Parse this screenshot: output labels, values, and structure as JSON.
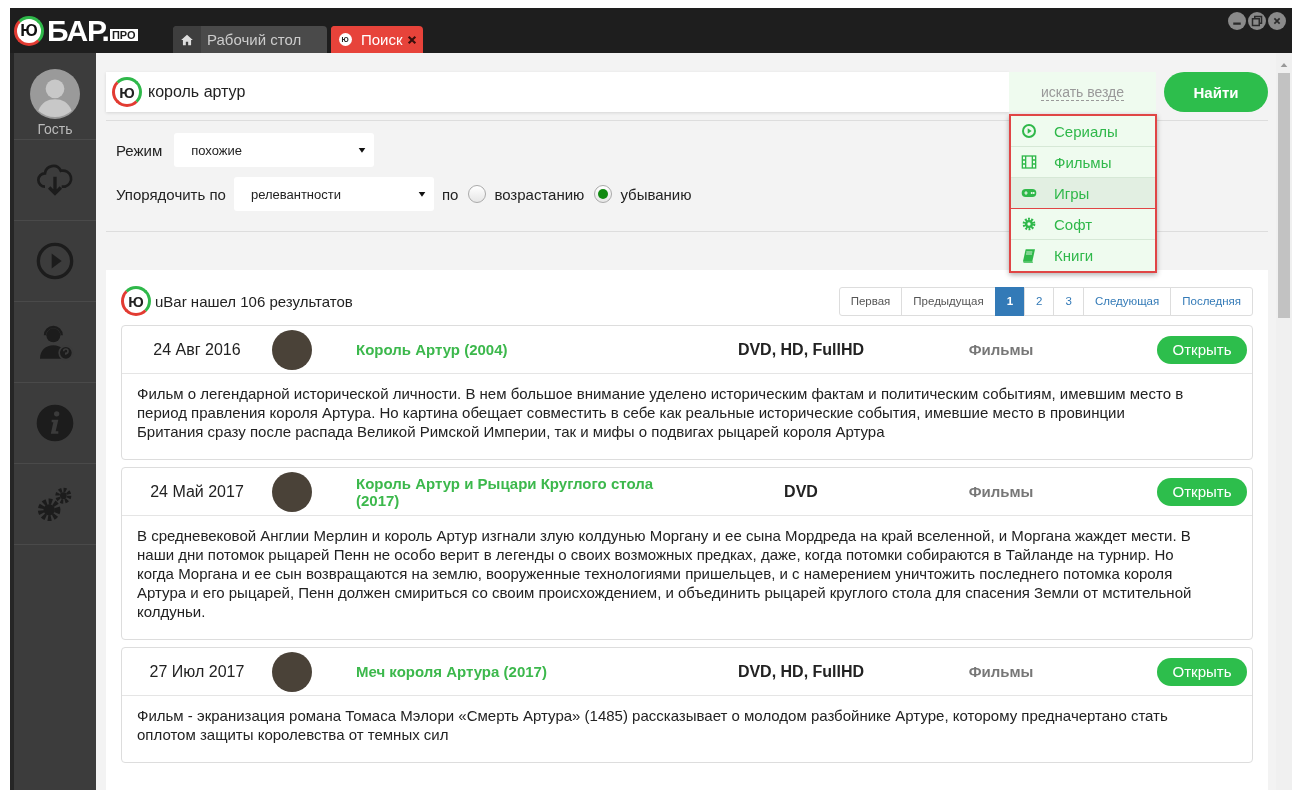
{
  "logo": {
    "mark": "Ю",
    "name": "БАР.",
    "suffix": "ПРО"
  },
  "tabs": [
    {
      "label": "Рабочий стол",
      "kind": "home",
      "selected": false,
      "closable": false
    },
    {
      "label": "Поиск",
      "kind": "logo",
      "mark": "Ю",
      "selected": true,
      "closable": true
    }
  ],
  "sidebar": {
    "user": {
      "name": "Гость"
    },
    "items": [
      {
        "kind": "cloud-download"
      },
      {
        "kind": "play"
      },
      {
        "kind": "support"
      },
      {
        "kind": "info"
      },
      {
        "kind": "gears"
      }
    ]
  },
  "search": {
    "mark": "Ю",
    "value": "король артур",
    "scope": "искать везде",
    "button": "Найти",
    "menu": [
      {
        "label": "Сериалы",
        "kind": "play",
        "selected": false
      },
      {
        "label": "Фильмы",
        "kind": "film",
        "selected": false
      },
      {
        "label": "Игры",
        "kind": "gamepad",
        "selected": true
      },
      {
        "label": "Софт",
        "kind": "gear",
        "selected": false
      },
      {
        "label": "Книги",
        "kind": "book",
        "selected": false
      }
    ]
  },
  "filters": {
    "mode": {
      "label": "Режим",
      "value": "похожие"
    },
    "sort": {
      "label": "Упорядочить по",
      "value": "релевантности",
      "connector": "по",
      "options": [
        {
          "label": "возрастанию",
          "selected": false
        },
        {
          "label": "убыванию",
          "selected": true
        }
      ]
    }
  },
  "results": {
    "mark": "Ю",
    "summary": "uBar нашел 106 результатов",
    "pagination": [
      {
        "label": "Первая",
        "selected": false
      },
      {
        "label": "Предыдущая",
        "selected": false
      },
      {
        "label": "1",
        "selected": true
      },
      {
        "label": "2",
        "selected": false
      },
      {
        "label": "3",
        "selected": false
      },
      {
        "label": "Следующая",
        "selected": false
      },
      {
        "label": "Последняя",
        "selected": false
      }
    ],
    "items": [
      {
        "date": "24 Авг 2016",
        "title": "Король Артур (2004)",
        "formats": "DVD, HD, FullHD",
        "category": "Фильмы",
        "button": "Открыть",
        "description": "Фильм  о легендарной исторической личности. В нем большое внимание уделено историческим фактам и политическим событиям, имевшим место в период правления короля Артура. Но картина обещает совместить в себе как реальные исторические события, имевшие место в провинции Британия сразу после распада Великой Римской Империи, так и мифы о подвигах рыцарей короля Артура"
      },
      {
        "date": "24 Май 2017",
        "title": "Король Артур и Рыцари Круглого стола (2017)",
        "formats": "DVD",
        "category": "Фильмы",
        "button": "Открыть",
        "description": "В средневековой Англии Мерлин и король Артур изгнали злую колдунью Моргану и ее сына Мордреда на край вселенной, и Моргана жаждет мести. В наши дни потомок рыцарей Пенн не особо верит в легенды о своих возможных предках, даже, когда потомки собираются в Тайланде на турнир. Но когда Моргана и ее сын возвращаются на землю, вооруженные технологиями пришельцев, и с намерением уничтожить последнего потомка короля Артура и его рыцарей, Пенн должен смириться со своим происхождением, и объединить рыцарей круглого стола для спасения Земли от мстительной колдуньи."
      },
      {
        "date": "27 Июл 2017",
        "title": "Меч короля Артура (2017)",
        "formats": "DVD, HD, FullHD",
        "category": "Фильмы",
        "button": "Открыть",
        "description": "Фильм - экранизация романа Томаса Мэлори «Смерть Артура» (1485) рассказывает о молодом разбойнике Артуре, которому предначертано стать оплотом защиты королевства от темных сил"
      }
    ]
  }
}
